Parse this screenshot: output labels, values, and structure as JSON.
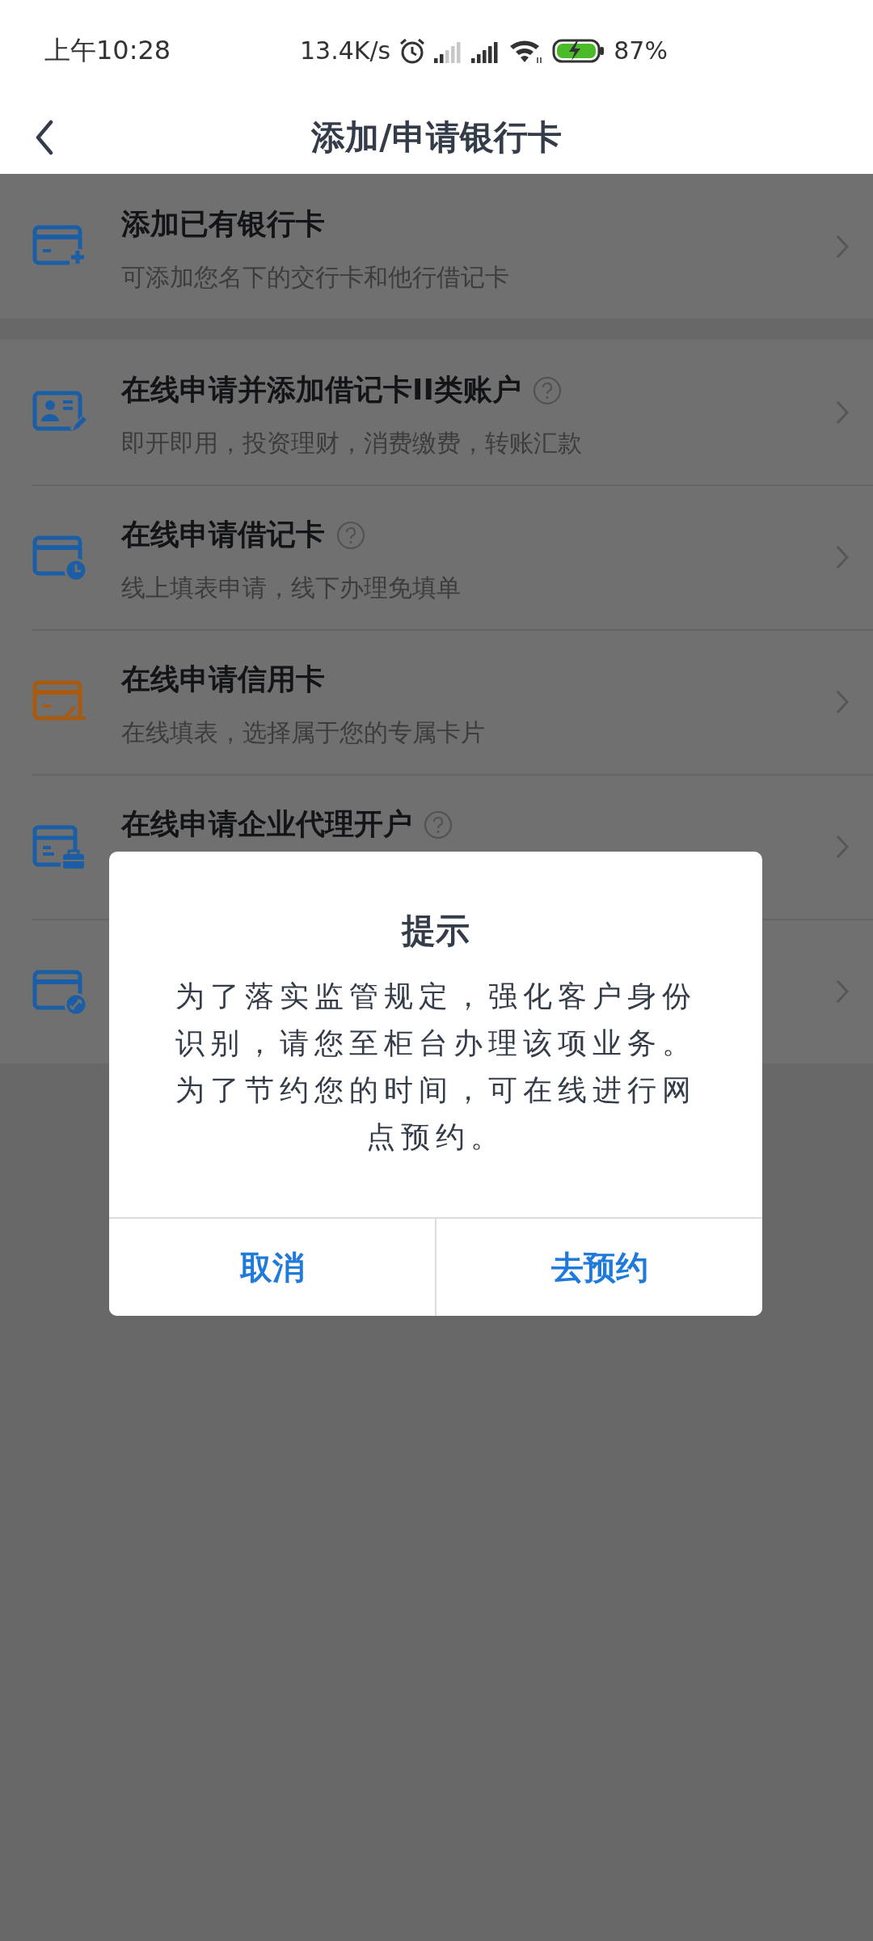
{
  "status_bar": {
    "time": "上午10:28",
    "net_speed": "13.4K/s",
    "battery_percent": "87%"
  },
  "header": {
    "title": "添加/申请银行卡"
  },
  "groups": [
    {
      "items": [
        {
          "kind": "add",
          "color": "#1b5ea5",
          "title": "添加已有银行卡",
          "subtitle": "可添加您名下的交行卡和他行借记卡"
        }
      ]
    },
    {
      "items": [
        {
          "kind": "profile",
          "color": "#1b5ea5",
          "title": "在线申请并添加借记卡II类账户",
          "subtitle": "即开即用，投资理财，消费缴费，转账汇款",
          "help": true
        },
        {
          "kind": "clock",
          "color": "#1b5ea5",
          "title": "在线申请借记卡",
          "subtitle": "线上填表申请，线下办理免填单",
          "help": true
        },
        {
          "kind": "pen",
          "color": "#a85a10",
          "title": "在线申请信用卡",
          "subtitle": "在线填表，选择属于您的专属卡片"
        },
        {
          "kind": "briefcase",
          "color": "#1b5ea5",
          "title": "在线申请企业代理开户",
          "help": true
        },
        {
          "kind": "link",
          "color": "#1b5ea5"
        }
      ]
    }
  ],
  "dialog": {
    "title": "提示",
    "message": "为了落实监管规定，强化客户身份识别，请您至柜台办理该项业务。为了节约您的时间，可在线进行网点预约。",
    "buttons": [
      {
        "label": "取消"
      },
      {
        "label": "去预约"
      }
    ]
  }
}
